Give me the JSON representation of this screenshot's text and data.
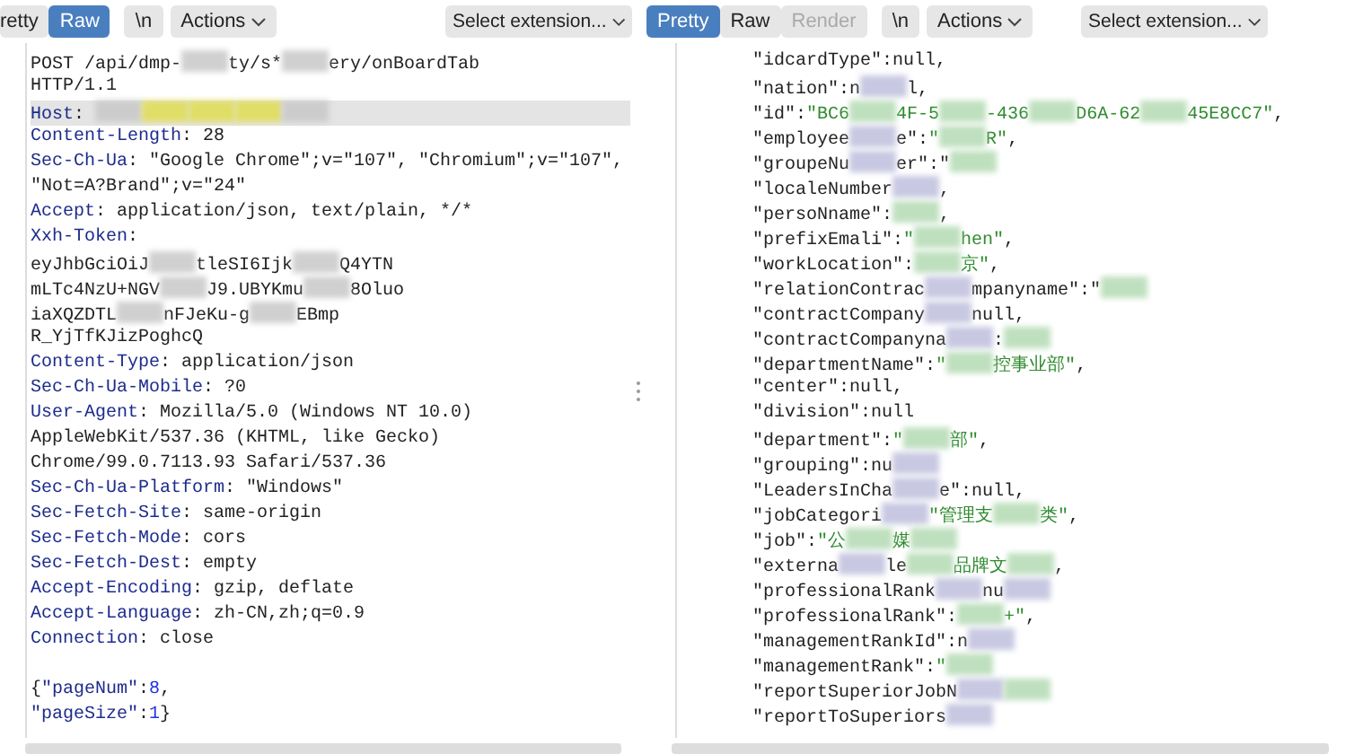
{
  "panels": [
    {
      "toolbar": {
        "tabs": [
          {
            "label": "retty",
            "selected": false,
            "disabled": false
          },
          {
            "label": "Raw",
            "selected": true,
            "disabled": false
          }
        ],
        "newline_button": "\\n",
        "actions_button": "Actions",
        "extension_select": "Select extension..."
      },
      "lines": [
        {
          "kind": "text",
          "highlighted": false,
          "segments": [
            {
              "kind": "plain",
              "text": "POST /api/dmp-"
            },
            {
              "kind": "blur",
              "color": "#d0d0d0"
            },
            {
              "kind": "plain",
              "text": "ty/s*"
            },
            {
              "kind": "blur",
              "color": "#d0d0d0"
            },
            {
              "kind": "plain",
              "text": "ery/onBoardTab"
            }
          ]
        },
        {
          "kind": "text",
          "highlighted": false,
          "segments": [
            {
              "kind": "plain",
              "text": "HTTP/1.1"
            }
          ]
        },
        {
          "kind": "text",
          "highlighted": true,
          "segments": [
            {
              "kind": "name",
              "text": "Host"
            },
            {
              "kind": "plain",
              "text": ": "
            },
            {
              "kind": "blur",
              "color": "#cccccc"
            },
            {
              "kind": "blur",
              "color": "#e0de66"
            },
            {
              "kind": "blur",
              "color": "#e0de66"
            },
            {
              "kind": "blur",
              "color": "#e0de66"
            },
            {
              "kind": "blur",
              "color": "#cccccc"
            }
          ]
        },
        {
          "kind": "text",
          "highlighted": false,
          "segments": [
            {
              "kind": "name",
              "text": "Content-Length"
            },
            {
              "kind": "plain",
              "text": ": 28"
            }
          ]
        },
        {
          "kind": "text",
          "highlighted": false,
          "segments": [
            {
              "kind": "name",
              "text": "Sec-Ch-Ua"
            },
            {
              "kind": "plain",
              "text": ": \"Google Chrome\";v=\"107\", \"Chromium\";v=\"107\","
            }
          ]
        },
        {
          "kind": "text",
          "highlighted": false,
          "segments": [
            {
              "kind": "plain",
              "text": "\"Not=A?Brand\";v=\"24\""
            }
          ]
        },
        {
          "kind": "text",
          "highlighted": false,
          "segments": [
            {
              "kind": "name",
              "text": "Accept"
            },
            {
              "kind": "plain",
              "text": ": application/json, text/plain, */*"
            }
          ]
        },
        {
          "kind": "text",
          "highlighted": false,
          "segments": [
            {
              "kind": "name",
              "text": "Xxh-Token"
            },
            {
              "kind": "plain",
              "text": ":"
            }
          ]
        },
        {
          "kind": "text",
          "highlighted": false,
          "segments": [
            {
              "kind": "plain",
              "text": "eyJhbGciOiJ"
            },
            {
              "kind": "blur",
              "color": "#d0d0d0"
            },
            {
              "kind": "plain",
              "text": "tleSI6Ijk"
            },
            {
              "kind": "blur",
              "color": "#d0d0d0"
            },
            {
              "kind": "plain",
              "text": "Q4YTN"
            }
          ]
        },
        {
          "kind": "text",
          "highlighted": false,
          "segments": [
            {
              "kind": "plain",
              "text": "mLTc4NzU+NGV"
            },
            {
              "kind": "blur",
              "color": "#d0d0d0"
            },
            {
              "kind": "plain",
              "text": "J9.UBYKmu"
            },
            {
              "kind": "blur",
              "color": "#d0d0d0"
            },
            {
              "kind": "plain",
              "text": "8Oluo"
            }
          ]
        },
        {
          "kind": "text",
          "highlighted": false,
          "segments": [
            {
              "kind": "plain",
              "text": "iaXQZDTL"
            },
            {
              "kind": "blur",
              "color": "#d0d0d0"
            },
            {
              "kind": "plain",
              "text": "nFJeKu-g"
            },
            {
              "kind": "blur",
              "color": "#d0d0d0"
            },
            {
              "kind": "plain",
              "text": "EBmp"
            }
          ]
        },
        {
          "kind": "text",
          "highlighted": false,
          "segments": [
            {
              "kind": "plain",
              "text": "R_YjTfKJizPoghcQ"
            }
          ]
        },
        {
          "kind": "text",
          "highlighted": false,
          "segments": [
            {
              "kind": "name",
              "text": "Content-Type"
            },
            {
              "kind": "plain",
              "text": ": application/json"
            }
          ]
        },
        {
          "kind": "text",
          "highlighted": false,
          "segments": [
            {
              "kind": "name",
              "text": "Sec-Ch-Ua-Mobile"
            },
            {
              "kind": "plain",
              "text": ": ?0"
            }
          ]
        },
        {
          "kind": "text",
          "highlighted": false,
          "segments": [
            {
              "kind": "name",
              "text": "User-Agent"
            },
            {
              "kind": "plain",
              "text": ": Mozilla/5.0 (Windows NT 10.0)"
            }
          ]
        },
        {
          "kind": "text",
          "highlighted": false,
          "segments": [
            {
              "kind": "plain",
              "text": "AppleWebKit/537.36 (KHTML, like Gecko)"
            }
          ]
        },
        {
          "kind": "text",
          "highlighted": false,
          "segments": [
            {
              "kind": "plain",
              "text": "Chrome/99.0.7113.93 Safari/537.36"
            }
          ]
        },
        {
          "kind": "text",
          "highlighted": false,
          "segments": [
            {
              "kind": "name",
              "text": "Sec-Ch-Ua-Platform"
            },
            {
              "kind": "plain",
              "text": ": \"Windows\""
            }
          ]
        },
        {
          "kind": "text",
          "highlighted": false,
          "segments": [
            {
              "kind": "name",
              "text": "Sec-Fetch-Site"
            },
            {
              "kind": "plain",
              "text": ": same-origin"
            }
          ]
        },
        {
          "kind": "text",
          "highlighted": false,
          "segments": [
            {
              "kind": "name",
              "text": "Sec-Fetch-Mode"
            },
            {
              "kind": "plain",
              "text": ": cors"
            }
          ]
        },
        {
          "kind": "text",
          "highlighted": false,
          "segments": [
            {
              "kind": "name",
              "text": "Sec-Fetch-Dest"
            },
            {
              "kind": "plain",
              "text": ": empty"
            }
          ]
        },
        {
          "kind": "text",
          "highlighted": false,
          "segments": [
            {
              "kind": "name",
              "text": "Accept-Encoding"
            },
            {
              "kind": "plain",
              "text": ": gzip, deflate"
            }
          ]
        },
        {
          "kind": "text",
          "highlighted": false,
          "segments": [
            {
              "kind": "name",
              "text": "Accept-Language"
            },
            {
              "kind": "plain",
              "text": ": zh-CN,zh;q=0.9"
            }
          ]
        },
        {
          "kind": "text",
          "highlighted": false,
          "segments": [
            {
              "kind": "name",
              "text": "Connection"
            },
            {
              "kind": "plain",
              "text": ": close"
            }
          ]
        },
        {
          "kind": "blank"
        },
        {
          "kind": "text",
          "highlighted": false,
          "segments": [
            {
              "kind": "plain",
              "text": "{"
            },
            {
              "kind": "name",
              "text": "\"pageNum\""
            },
            {
              "kind": "plain",
              "text": ":"
            },
            {
              "kind": "num",
              "text": "8"
            },
            {
              "kind": "plain",
              "text": ","
            }
          ]
        },
        {
          "kind": "text",
          "highlighted": false,
          "segments": [
            {
              "kind": "name",
              "text": "\"pageSize\""
            },
            {
              "kind": "plain",
              "text": ":"
            },
            {
              "kind": "num",
              "text": "1"
            },
            {
              "kind": "plain",
              "text": "}"
            }
          ]
        }
      ]
    },
    {
      "toolbar": {
        "tabs": [
          {
            "label": "Pretty",
            "selected": true,
            "disabled": false
          },
          {
            "label": "Raw",
            "selected": false,
            "disabled": false
          },
          {
            "label": "Render",
            "selected": false,
            "disabled": true
          }
        ],
        "newline_button": "\\n",
        "actions_button": "Actions",
        "extension_select": "Select extension..."
      },
      "lines": [
        {
          "kind": "text",
          "highlighted": false,
          "segments": [
            {
              "kind": "plain",
              "text": "\"idcardType\":null,"
            }
          ]
        },
        {
          "kind": "text",
          "highlighted": false,
          "segments": [
            {
              "kind": "plain",
              "text": "\"nation\":n"
            },
            {
              "kind": "blur",
              "color": "#c8c8e2"
            },
            {
              "kind": "plain",
              "text": "l,"
            }
          ]
        },
        {
          "kind": "text",
          "highlighted": false,
          "segments": [
            {
              "kind": "plain",
              "text": "\"id\":"
            },
            {
              "kind": "str",
              "text": "\"BC6"
            },
            {
              "kind": "blur",
              "color": "#bfe0bf"
            },
            {
              "kind": "str",
              "text": "4F-5"
            },
            {
              "kind": "blur",
              "color": "#bfe0bf"
            },
            {
              "kind": "str",
              "text": "-436"
            },
            {
              "kind": "blur",
              "color": "#bfe0bf"
            },
            {
              "kind": "str",
              "text": "D6A-62"
            },
            {
              "kind": "blur",
              "color": "#bfe0bf"
            },
            {
              "kind": "str",
              "text": "45E8CC7\""
            },
            {
              "kind": "plain",
              "text": ","
            }
          ]
        },
        {
          "kind": "text",
          "highlighted": false,
          "segments": [
            {
              "kind": "plain",
              "text": "\"employee"
            },
            {
              "kind": "blur",
              "color": "#c8c8e2"
            },
            {
              "kind": "plain",
              "text": "e\":"
            },
            {
              "kind": "str",
              "text": "\""
            },
            {
              "kind": "blur",
              "color": "#bfe0bf"
            },
            {
              "kind": "str",
              "text": "R\""
            },
            {
              "kind": "plain",
              "text": ","
            }
          ]
        },
        {
          "kind": "text",
          "highlighted": false,
          "segments": [
            {
              "kind": "plain",
              "text": "\"groupeNu"
            },
            {
              "kind": "blur",
              "color": "#c8c8e2"
            },
            {
              "kind": "plain",
              "text": "er\":\""
            },
            {
              "kind": "blur",
              "color": "#bfe0bf"
            }
          ]
        },
        {
          "kind": "text",
          "highlighted": false,
          "segments": [
            {
              "kind": "plain",
              "text": "\"localeNumber"
            },
            {
              "kind": "blur",
              "color": "#c8c8e2"
            },
            {
              "kind": "plain",
              "text": ","
            }
          ]
        },
        {
          "kind": "text",
          "highlighted": false,
          "segments": [
            {
              "kind": "plain",
              "text": "\"persoNname\":"
            },
            {
              "kind": "blur",
              "color": "#bfe0bf"
            },
            {
              "kind": "plain",
              "text": ","
            }
          ]
        },
        {
          "kind": "text",
          "highlighted": false,
          "segments": [
            {
              "kind": "plain",
              "text": "\"prefixEmali\":"
            },
            {
              "kind": "str",
              "text": "\""
            },
            {
              "kind": "blur",
              "color": "#bfe0bf"
            },
            {
              "kind": "str",
              "text": "hen\""
            },
            {
              "kind": "plain",
              "text": ","
            }
          ]
        },
        {
          "kind": "text",
          "highlighted": false,
          "segments": [
            {
              "kind": "plain",
              "text": "\"workLocation\":"
            },
            {
              "kind": "blur",
              "color": "#bfe0bf"
            },
            {
              "kind": "str",
              "text": "京\""
            },
            {
              "kind": "plain",
              "text": ","
            }
          ]
        },
        {
          "kind": "text",
          "highlighted": false,
          "segments": [
            {
              "kind": "plain",
              "text": "\"relationContrac"
            },
            {
              "kind": "blur",
              "color": "#c8c8e2"
            },
            {
              "kind": "plain",
              "text": "mpanyname\":\""
            },
            {
              "kind": "blur",
              "color": "#bfe0bf"
            }
          ]
        },
        {
          "kind": "text",
          "highlighted": false,
          "segments": [
            {
              "kind": "plain",
              "text": "\"contractCompany"
            },
            {
              "kind": "blur",
              "color": "#c8c8e2"
            },
            {
              "kind": "plain",
              "text": "null,"
            }
          ]
        },
        {
          "kind": "text",
          "highlighted": false,
          "segments": [
            {
              "kind": "plain",
              "text": "\"contractCompanyna"
            },
            {
              "kind": "blur",
              "color": "#c8c8e2"
            },
            {
              "kind": "plain",
              "text": ":"
            },
            {
              "kind": "blur",
              "color": "#bfe0bf"
            }
          ]
        },
        {
          "kind": "text",
          "highlighted": false,
          "segments": [
            {
              "kind": "plain",
              "text": "\"departmentName\":"
            },
            {
              "kind": "str",
              "text": "\""
            },
            {
              "kind": "blur",
              "color": "#bfe0bf"
            },
            {
              "kind": "str",
              "text": "控事业部\""
            },
            {
              "kind": "plain",
              "text": ","
            }
          ]
        },
        {
          "kind": "text",
          "highlighted": false,
          "segments": [
            {
              "kind": "plain",
              "text": "\"center\":null,"
            }
          ]
        },
        {
          "kind": "text",
          "highlighted": false,
          "segments": [
            {
              "kind": "plain",
              "text": "\"division\":null"
            }
          ]
        },
        {
          "kind": "text",
          "highlighted": false,
          "segments": [
            {
              "kind": "plain",
              "text": "\"department\":"
            },
            {
              "kind": "str",
              "text": "\""
            },
            {
              "kind": "blur",
              "color": "#bfe0bf"
            },
            {
              "kind": "str",
              "text": "部\""
            },
            {
              "kind": "plain",
              "text": ","
            }
          ]
        },
        {
          "kind": "text",
          "highlighted": false,
          "segments": [
            {
              "kind": "plain",
              "text": "\"grouping\":nu"
            },
            {
              "kind": "blur",
              "color": "#c8c8e2"
            }
          ]
        },
        {
          "kind": "text",
          "highlighted": false,
          "segments": [
            {
              "kind": "plain",
              "text": "\"LeadersInCha"
            },
            {
              "kind": "blur",
              "color": "#c8c8e2"
            },
            {
              "kind": "plain",
              "text": "e\":null,"
            }
          ]
        },
        {
          "kind": "text",
          "highlighted": false,
          "segments": [
            {
              "kind": "plain",
              "text": "\"jobCategori"
            },
            {
              "kind": "blur",
              "color": "#c8c8e2"
            },
            {
              "kind": "str",
              "text": "\"管理支"
            },
            {
              "kind": "blur",
              "color": "#bfe0bf"
            },
            {
              "kind": "str",
              "text": "类\""
            },
            {
              "kind": "plain",
              "text": ","
            }
          ]
        },
        {
          "kind": "text",
          "highlighted": false,
          "segments": [
            {
              "kind": "plain",
              "text": "\"job\":"
            },
            {
              "kind": "str",
              "text": "\"公"
            },
            {
              "kind": "blur",
              "color": "#bfe0bf"
            },
            {
              "kind": "str",
              "text": "媒"
            },
            {
              "kind": "blur",
              "color": "#bfe0bf"
            }
          ]
        },
        {
          "kind": "text",
          "highlighted": false,
          "segments": [
            {
              "kind": "plain",
              "text": "\"externa"
            },
            {
              "kind": "blur",
              "color": "#c8c8e2"
            },
            {
              "kind": "plain",
              "text": "le"
            },
            {
              "kind": "blur",
              "color": "#bfe0bf"
            },
            {
              "kind": "str",
              "text": "品牌文"
            },
            {
              "kind": "blur",
              "color": "#bfe0bf"
            },
            {
              "kind": "plain",
              "text": ","
            }
          ]
        },
        {
          "kind": "text",
          "highlighted": false,
          "segments": [
            {
              "kind": "plain",
              "text": "\"professionalRank"
            },
            {
              "kind": "blur",
              "color": "#c8c8e2"
            },
            {
              "kind": "plain",
              "text": "nu"
            },
            {
              "kind": "blur",
              "color": "#c8c8e2"
            }
          ]
        },
        {
          "kind": "text",
          "highlighted": false,
          "segments": [
            {
              "kind": "plain",
              "text": "\"professionalRank\":"
            },
            {
              "kind": "blur",
              "color": "#bfe0bf"
            },
            {
              "kind": "str",
              "text": "+\""
            },
            {
              "kind": "plain",
              "text": ","
            }
          ]
        },
        {
          "kind": "text",
          "highlighted": false,
          "segments": [
            {
              "kind": "plain",
              "text": "\"managementRankId\":n"
            },
            {
              "kind": "blur",
              "color": "#c8c8e2"
            }
          ]
        },
        {
          "kind": "text",
          "highlighted": false,
          "segments": [
            {
              "kind": "plain",
              "text": "\"managementRank\":"
            },
            {
              "kind": "str",
              "text": "\""
            },
            {
              "kind": "blur",
              "color": "#bfe0bf"
            }
          ]
        },
        {
          "kind": "text",
          "highlighted": false,
          "segments": [
            {
              "kind": "plain",
              "text": "\"reportSuperiorJobN"
            },
            {
              "kind": "blur",
              "color": "#c8c8e2"
            },
            {
              "kind": "blur",
              "color": "#bfe0bf"
            }
          ]
        },
        {
          "kind": "text",
          "highlighted": false,
          "segments": [
            {
              "kind": "plain",
              "text": "\"reportToSuperiors"
            },
            {
              "kind": "blur",
              "color": "#c8c8e2"
            }
          ]
        }
      ]
    }
  ]
}
